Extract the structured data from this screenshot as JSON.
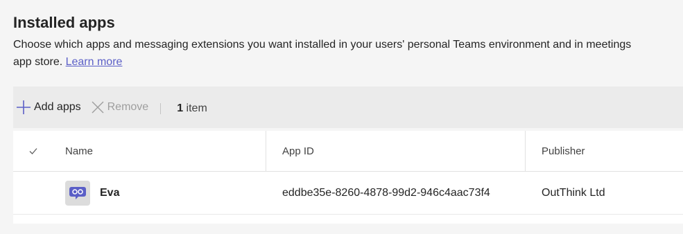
{
  "header": {
    "title": "Installed apps",
    "description_line1": "Choose which apps and messaging extensions you want installed in your users' personal Teams environment and in meetings",
    "description_line2": "app store.",
    "learn_more": "Learn more"
  },
  "toolbar": {
    "add_label": "Add apps",
    "remove_label": "Remove",
    "count_number": "1",
    "count_label": "item"
  },
  "table": {
    "columns": [
      "Name",
      "App ID",
      "Publisher"
    ],
    "rows": [
      {
        "name": "Eva",
        "app_id": "eddbe35e-8260-4878-99d2-946c4aac73f4",
        "publisher": "OutThink Ltd",
        "icon": "chat-bot-icon"
      }
    ]
  },
  "colors": {
    "accent": "#5b5fc7",
    "disabled": "#9e9e9e"
  }
}
